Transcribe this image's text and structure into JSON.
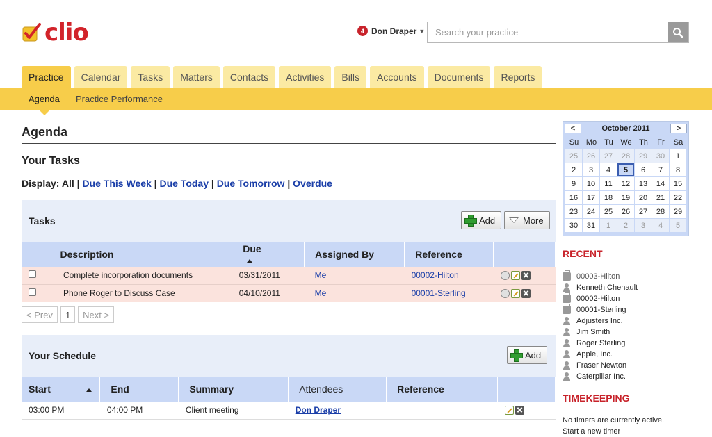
{
  "brand": {
    "name": "clio"
  },
  "user": {
    "name": "Don Draper",
    "notifications": "4"
  },
  "search": {
    "placeholder": "Search your practice"
  },
  "tabs": [
    "Practice",
    "Calendar",
    "Tasks",
    "Matters",
    "Contacts",
    "Activities",
    "Bills",
    "Accounts",
    "Documents",
    "Reports"
  ],
  "subnav": [
    "Agenda",
    "Practice Performance"
  ],
  "page": {
    "title": "Agenda",
    "section": "Your Tasks"
  },
  "display": {
    "label": "Display:",
    "all": "All",
    "sep": "|",
    "links": [
      "Due This Week",
      "Due Today",
      "Due Tomorrow",
      "Overdue"
    ]
  },
  "tasks": {
    "title": "Tasks",
    "add_label": "Add",
    "more_label": "More",
    "columns": [
      "Description",
      "Due",
      "Assigned By",
      "Reference"
    ],
    "rows": [
      {
        "description": "Complete incorporation documents",
        "due": "03/31/2011",
        "assigned_by": "Me",
        "reference": "00002-Hilton"
      },
      {
        "description": "Phone Roger to Discuss Case",
        "due": "04/10/2011",
        "assigned_by": "Me",
        "reference": "00001-Sterling"
      }
    ],
    "pager": {
      "prev": "< Prev",
      "page": "1",
      "next": "Next >"
    }
  },
  "schedule": {
    "title": "Your Schedule",
    "add_label": "Add",
    "columns": [
      "Start",
      "End",
      "Summary",
      "Attendees",
      "Reference"
    ],
    "rows": [
      {
        "start": "03:00 PM",
        "end": "04:00 PM",
        "summary": "Client meeting",
        "attendees": "Don Draper",
        "reference": ""
      }
    ]
  },
  "calendar": {
    "month": "October 2011",
    "prev": "<",
    "next": ">",
    "dow": [
      "Su",
      "Mo",
      "Tu",
      "We",
      "Th",
      "Fr",
      "Sa"
    ],
    "weeks": [
      [
        "25",
        "26",
        "27",
        "28",
        "29",
        "30",
        "1"
      ],
      [
        "2",
        "3",
        "4",
        "5",
        "6",
        "7",
        "8"
      ],
      [
        "9",
        "10",
        "11",
        "12",
        "13",
        "14",
        "15"
      ],
      [
        "16",
        "17",
        "18",
        "19",
        "20",
        "21",
        "22"
      ],
      [
        "23",
        "24",
        "25",
        "26",
        "27",
        "28",
        "29"
      ],
      [
        "30",
        "31",
        "1",
        "2",
        "3",
        "4",
        "5"
      ]
    ],
    "today": "5"
  },
  "recent": {
    "title": "RECENT",
    "items": [
      {
        "label": "00003-Hilton",
        "icon": "case-icon"
      },
      {
        "label": "Kenneth Chenault",
        "icon": "person-icon"
      },
      {
        "label": "00002-Hilton",
        "icon": "case-icon"
      },
      {
        "label": "00001-Sterling",
        "icon": "case-icon"
      },
      {
        "label": "Adjusters Inc.",
        "icon": "person-icon"
      },
      {
        "label": "Jim Smith",
        "icon": "person-icon"
      },
      {
        "label": "Roger Sterling",
        "icon": "person-icon"
      },
      {
        "label": "Apple, Inc.",
        "icon": "person-icon"
      },
      {
        "label": "Fraser Newton",
        "icon": "person-icon"
      },
      {
        "label": "Caterpillar Inc.",
        "icon": "person-icon"
      }
    ]
  },
  "timekeeping": {
    "title": "TIMEKEEPING",
    "status": "No timers are currently active.",
    "start_link": "Start a new timer"
  },
  "colors": {
    "brand_red": "#d2232a",
    "tab_active": "#f7cd4a",
    "tab_inactive": "#fbeaa3",
    "header_blue": "#c9d8f6",
    "row_pink": "#fbe3dd",
    "link_blue": "#1a3ea8"
  }
}
